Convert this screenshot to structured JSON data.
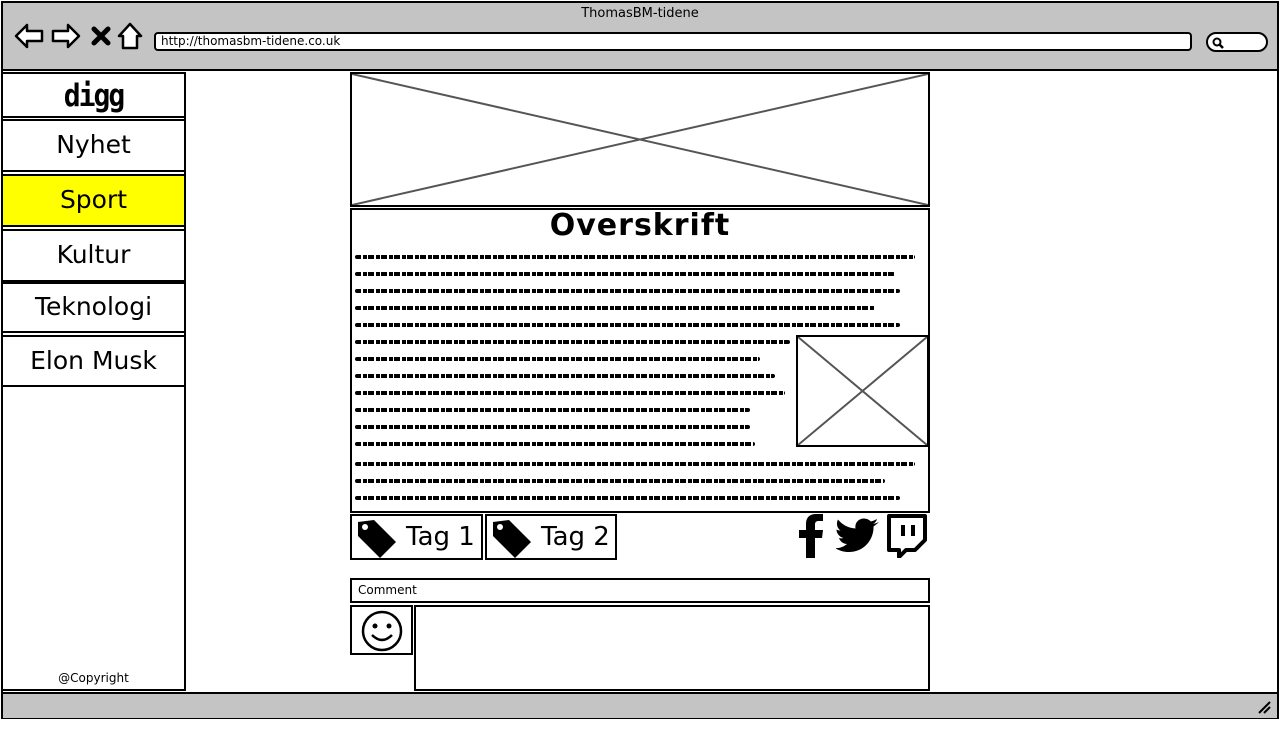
{
  "browser": {
    "title": "ThomasBM-tidene",
    "url": "http://thomasbm-tidene.co.uk"
  },
  "sidebar": {
    "logo": "digg",
    "items": [
      {
        "label": "Nyhet",
        "active": false
      },
      {
        "label": "Sport",
        "active": true
      },
      {
        "label": "Kultur",
        "active": false
      },
      {
        "label": "Teknologi",
        "active": false
      },
      {
        "label": "Elon Musk",
        "active": false
      }
    ],
    "copyright": "@Copyright"
  },
  "article": {
    "headline": "Overskrift"
  },
  "tags": [
    {
      "label": "Tag 1"
    },
    {
      "label": "Tag 2"
    }
  ],
  "comment": {
    "label": "Comment"
  },
  "social": [
    "facebook-icon",
    "twitter-icon",
    "twitch-icon"
  ],
  "colors": {
    "active_nav": "#ffff00",
    "chrome": "#c4c4c4"
  }
}
